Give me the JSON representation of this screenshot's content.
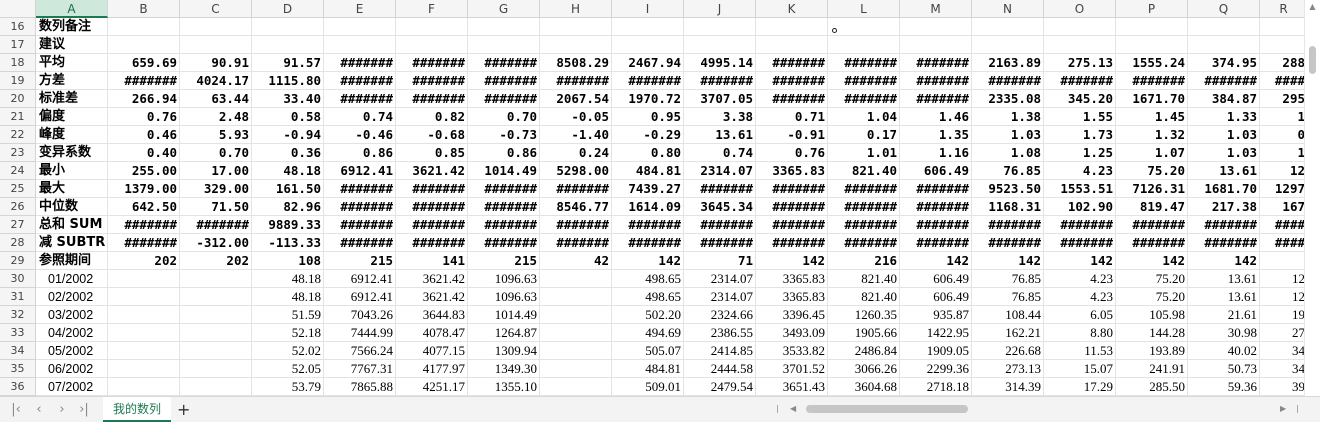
{
  "columns": [
    {
      "label": "A",
      "w": 72
    },
    {
      "label": "B",
      "w": 72
    },
    {
      "label": "C",
      "w": 72
    },
    {
      "label": "D",
      "w": 72
    },
    {
      "label": "E",
      "w": 72
    },
    {
      "label": "F",
      "w": 72
    },
    {
      "label": "G",
      "w": 72
    },
    {
      "label": "H",
      "w": 72
    },
    {
      "label": "I",
      "w": 72
    },
    {
      "label": "J",
      "w": 72
    },
    {
      "label": "K",
      "w": 72
    },
    {
      "label": "L",
      "w": 72
    },
    {
      "label": "M",
      "w": 72
    },
    {
      "label": "N",
      "w": 72
    },
    {
      "label": "O",
      "w": 72
    },
    {
      "label": "P",
      "w": 72
    },
    {
      "label": "Q",
      "w": 72
    },
    {
      "label": "R",
      "w": 48
    }
  ],
  "selected_column": "A",
  "rows": [
    {
      "num": "16",
      "cells": [
        "数列备注",
        "",
        "",
        "",
        "",
        "",
        "",
        "",
        "",
        "",
        "",
        "",
        "",
        "",
        "",
        "",
        "",
        ""
      ]
    },
    {
      "num": "17",
      "cells": [
        "建议",
        "",
        "",
        "",
        "",
        "",
        "",
        "",
        "",
        "",
        "",
        "",
        "",
        "",
        "",
        "",
        "",
        ""
      ]
    },
    {
      "num": "18",
      "cells": [
        "平均",
        "659.69",
        "90.91",
        "91.57",
        "#######",
        "#######",
        "#######",
        "8508.29",
        "2467.94",
        "4995.14",
        "#######",
        "#######",
        "#######",
        "2163.89",
        "275.13",
        "1555.24",
        "374.95",
        "288"
      ]
    },
    {
      "num": "19",
      "cells": [
        "方差",
        "#######",
        "4024.17",
        "1115.80",
        "#######",
        "#######",
        "#######",
        "#######",
        "#######",
        "#######",
        "#######",
        "#######",
        "#######",
        "#######",
        "#######",
        "#######",
        "#######",
        "####"
      ]
    },
    {
      "num": "20",
      "cells": [
        "标准差",
        "266.94",
        "63.44",
        "33.40",
        "#######",
        "#######",
        "#######",
        "2067.54",
        "1970.72",
        "3707.05",
        "#######",
        "#######",
        "#######",
        "2335.08",
        "345.20",
        "1671.70",
        "384.87",
        "295"
      ]
    },
    {
      "num": "21",
      "cells": [
        "偏度",
        "0.76",
        "2.48",
        "0.58",
        "0.74",
        "0.82",
        "0.70",
        "-0.05",
        "0.95",
        "3.38",
        "0.71",
        "1.04",
        "1.46",
        "1.38",
        "1.55",
        "1.45",
        "1.33",
        "1"
      ]
    },
    {
      "num": "22",
      "cells": [
        "峰度",
        "0.46",
        "5.93",
        "-0.94",
        "-0.46",
        "-0.68",
        "-0.73",
        "-1.40",
        "-0.29",
        "13.61",
        "-0.91",
        "0.17",
        "1.35",
        "1.03",
        "1.73",
        "1.32",
        "1.03",
        "0"
      ]
    },
    {
      "num": "23",
      "cells": [
        "变异系数",
        "0.40",
        "0.70",
        "0.36",
        "0.86",
        "0.85",
        "0.86",
        "0.24",
        "0.80",
        "0.74",
        "0.76",
        "1.01",
        "1.16",
        "1.08",
        "1.25",
        "1.07",
        "1.03",
        "1"
      ]
    },
    {
      "num": "24",
      "cells": [
        "最小",
        "255.00",
        "17.00",
        "48.18",
        "6912.41",
        "3621.42",
        "1014.49",
        "5298.00",
        "484.81",
        "2314.07",
        "3365.83",
        "821.40",
        "606.49",
        "76.85",
        "4.23",
        "75.20",
        "13.61",
        "12"
      ]
    },
    {
      "num": "25",
      "cells": [
        "最大",
        "1379.00",
        "329.00",
        "161.50",
        "#######",
        "#######",
        "#######",
        "#######",
        "7439.27",
        "#######",
        "#######",
        "#######",
        "#######",
        "9523.50",
        "1553.51",
        "7126.31",
        "1681.70",
        "1297"
      ]
    },
    {
      "num": "26",
      "cells": [
        "中位数",
        "642.50",
        "71.50",
        "82.96",
        "#######",
        "#######",
        "#######",
        "8546.77",
        "1614.09",
        "3645.34",
        "#######",
        "#######",
        "#######",
        "1168.31",
        "102.90",
        "819.47",
        "217.38",
        "167"
      ]
    },
    {
      "num": "27",
      "cells": [
        "总和 SUM",
        "#######",
        "#######",
        "9889.33",
        "#######",
        "#######",
        "#######",
        "#######",
        "#######",
        "#######",
        "#######",
        "#######",
        "#######",
        "#######",
        "#######",
        "#######",
        "#######",
        "####"
      ]
    },
    {
      "num": "28",
      "cells": [
        "减 SUBTR",
        "#######",
        "-312.00",
        "-113.33",
        "#######",
        "#######",
        "#######",
        "#######",
        "#######",
        "#######",
        "#######",
        "#######",
        "#######",
        "#######",
        "#######",
        "#######",
        "#######",
        "####"
      ]
    },
    {
      "num": "29",
      "cells": [
        "参照期间",
        "202",
        "202",
        "108",
        "215",
        "141",
        "215",
        "42",
        "142",
        "71",
        "142",
        "216",
        "142",
        "142",
        "142",
        "142",
        "142",
        ""
      ]
    },
    {
      "num": "30",
      "cells": [
        "01/2002",
        "",
        "",
        "48.18",
        "6912.41",
        "3621.42",
        "1096.63",
        "",
        "498.65",
        "2314.07",
        "3365.83",
        "821.40",
        "606.49",
        "76.85",
        "4.23",
        "75.20",
        "13.61",
        "12"
      ]
    },
    {
      "num": "31",
      "cells": [
        "02/2002",
        "",
        "",
        "48.18",
        "6912.41",
        "3621.42",
        "1096.63",
        "",
        "498.65",
        "2314.07",
        "3365.83",
        "821.40",
        "606.49",
        "76.85",
        "4.23",
        "75.20",
        "13.61",
        "12"
      ]
    },
    {
      "num": "32",
      "cells": [
        "03/2002",
        "",
        "",
        "51.59",
        "7043.26",
        "3644.83",
        "1014.49",
        "",
        "502.20",
        "2324.66",
        "3396.45",
        "1260.35",
        "935.87",
        "108.44",
        "6.05",
        "105.98",
        "21.61",
        "19"
      ]
    },
    {
      "num": "33",
      "cells": [
        "04/2002",
        "",
        "",
        "52.18",
        "7444.99",
        "4078.47",
        "1264.87",
        "",
        "494.69",
        "2386.55",
        "3493.09",
        "1905.66",
        "1422.95",
        "162.21",
        "8.80",
        "144.28",
        "30.98",
        "27"
      ]
    },
    {
      "num": "34",
      "cells": [
        "05/2002",
        "",
        "",
        "52.02",
        "7566.24",
        "4077.15",
        "1309.94",
        "",
        "505.07",
        "2414.85",
        "3533.82",
        "2486.84",
        "1909.05",
        "226.68",
        "11.53",
        "193.89",
        "40.02",
        "34"
      ]
    },
    {
      "num": "35",
      "cells": [
        "06/2002",
        "",
        "",
        "52.05",
        "7767.31",
        "4177.97",
        "1349.30",
        "",
        "484.81",
        "2444.58",
        "3701.52",
        "3066.26",
        "2299.36",
        "273.13",
        "15.07",
        "241.91",
        "50.73",
        "34"
      ]
    },
    {
      "num": "36",
      "cells": [
        "07/2002",
        "",
        "",
        "53.79",
        "7865.88",
        "4251.17",
        "1355.10",
        "",
        "509.01",
        "2479.54",
        "3651.43",
        "3604.68",
        "2718.18",
        "314.39",
        "17.29",
        "285.50",
        "59.36",
        "39"
      ]
    }
  ],
  "sheet_tab": "我的数列",
  "add_sheet": "+",
  "nav": {
    "first": "|‹",
    "prev": "‹",
    "next": "›",
    "last": "›|"
  },
  "colors": {
    "accent": "#1d7a50",
    "header_bg": "#f5f5f5",
    "grid": "#e3e3e3"
  }
}
